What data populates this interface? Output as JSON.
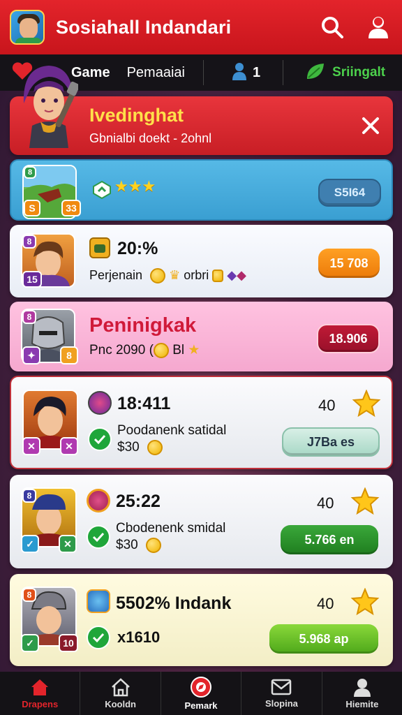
{
  "header": {
    "title": "Sosiahall Indandari",
    "icons": [
      "app-logo",
      "search-icon",
      "profile-icon"
    ]
  },
  "tabs": {
    "game": "Game",
    "pemaaiai": "Pemaaiai",
    "player_count": "1",
    "status": "Sriingalt"
  },
  "rows": [
    {
      "title": "Ivedinghat",
      "subtitle": "Gbnialbi doekt - 2ohnl"
    },
    {
      "rank": "8",
      "score_left": "S",
      "score_right": "33",
      "price": "S5I64"
    },
    {
      "rank": "8",
      "title": "20:%",
      "subtitle": "Perjenain",
      "subtitle_extra": "orbri",
      "badge_left": "15",
      "price": "15 708"
    },
    {
      "rank": "8",
      "title": "Peninigkak",
      "subtitle": "Pnc 2090 (",
      "subtitle_extra": "Bl",
      "badge_right": "8",
      "price": "18.906"
    },
    {
      "title": "18:411",
      "count": "40",
      "line1": "Poodanenk satidal",
      "line2": "$30",
      "price": "J7Ba es"
    },
    {
      "rank": "8",
      "title": "25:22",
      "count": "40",
      "line1": "Cbodenenk smidal",
      "line2": "$30",
      "price": "5.766 en"
    },
    {
      "rank": "8",
      "title": "5502% Indank",
      "count": "40",
      "line1": "x1610",
      "badge_right": "10",
      "price": "5.968 ap"
    }
  ],
  "nav": [
    {
      "label": "Drapens",
      "icon": "home-icon"
    },
    {
      "label": "Kooldn",
      "icon": "house-outline-icon"
    },
    {
      "label": "Pemark",
      "icon": "compass-icon"
    },
    {
      "label": "Slopina",
      "icon": "mail-icon"
    },
    {
      "label": "Hiemite",
      "icon": "user-icon"
    }
  ],
  "colors": {
    "header_red": "#d41c22",
    "accent_green": "#2f9e2f",
    "accent_orange": "#f5900f",
    "accent_crimson": "#b0122a"
  }
}
